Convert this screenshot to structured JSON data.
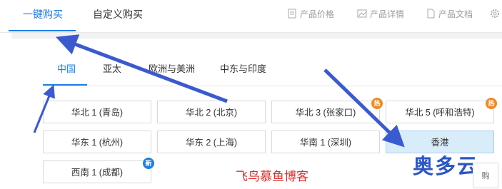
{
  "top_tabs": [
    "一键购买",
    "自定义购买"
  ],
  "top_links": [
    "产品价格",
    "产品详情",
    "产品文档",
    ""
  ],
  "region_tabs": [
    "中国",
    "亚太",
    "欧洲与美洲",
    "中东与印度"
  ],
  "regions": [
    {
      "label": "华北 1 (青岛)"
    },
    {
      "label": "华北 2 (北京)"
    },
    {
      "label": "华北 3 (张家口)",
      "badge": "hot",
      "badge_text": "热"
    },
    {
      "label": "华北 5 (呼和浩特)",
      "badge": "hot",
      "badge_text": "热"
    },
    {
      "label": "华东 1 (杭州)"
    },
    {
      "label": "华东 2 (上海)"
    },
    {
      "label": "华南 1 (深圳)"
    },
    {
      "label": "香港",
      "selected": true
    },
    {
      "label": "西南 1 (成都)",
      "badge": "new",
      "badge_text": "新"
    }
  ],
  "watermark_blog": "飞鸟慕鱼博客",
  "watermark_brand": "奥多云",
  "side_widget": "购",
  "colors": {
    "accent": "#1e7fe6",
    "arrow": "#3a5ad0",
    "selected_bg": "#d9ecfa",
    "hot": "#f08a24"
  }
}
